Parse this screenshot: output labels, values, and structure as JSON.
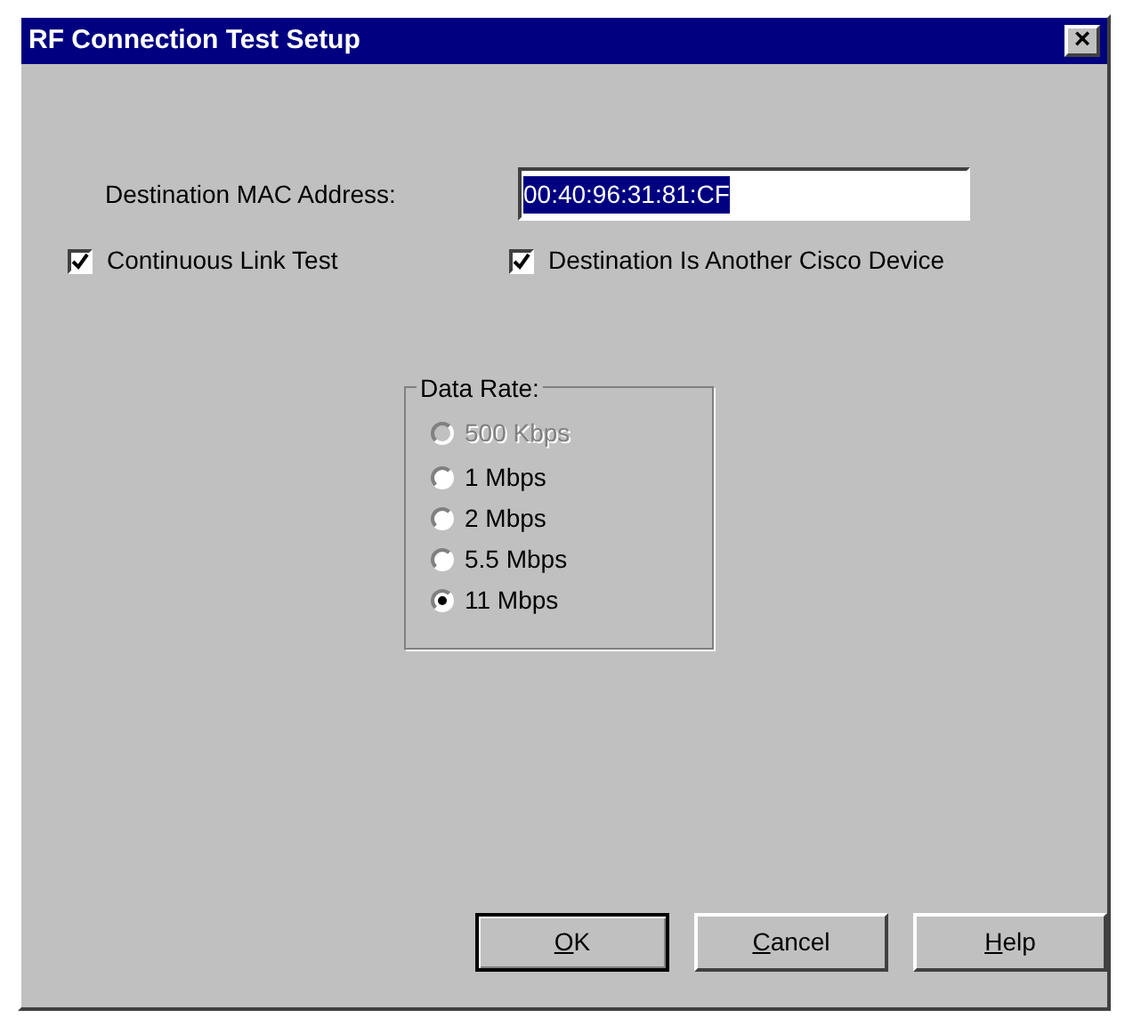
{
  "window": {
    "title": "RF Connection Test Setup",
    "close_label": "×"
  },
  "mac": {
    "label": "Destination MAC Address:",
    "value": "00:40:96:31:81:CF",
    "selected_text": true
  },
  "checkboxes": [
    {
      "label": "Continuous Link Test",
      "checked": true
    },
    {
      "label": "Destination Is Another Cisco Device",
      "checked": true
    }
  ],
  "data_rate": {
    "title": "Data Rate:",
    "options": [
      {
        "label": "500 Kbps",
        "selected": false,
        "disabled": true
      },
      {
        "label": "1 Mbps",
        "selected": false,
        "disabled": false
      },
      {
        "label": "2 Mbps",
        "selected": false,
        "disabled": false
      },
      {
        "label": "5.5 Mbps",
        "selected": false,
        "disabled": false
      },
      {
        "label": "11 Mbps",
        "selected": true,
        "disabled": false
      }
    ]
  },
  "buttons": [
    {
      "mnemonic": "O",
      "rest": "K",
      "default": true
    },
    {
      "mnemonic": "C",
      "rest": "ancel",
      "default": false
    },
    {
      "mnemonic": "H",
      "rest": "elp",
      "default": false
    }
  ]
}
